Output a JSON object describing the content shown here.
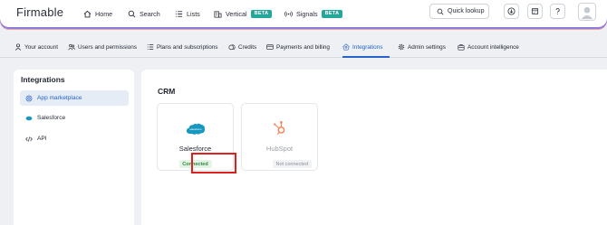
{
  "brand": {
    "name": "Firmable"
  },
  "topnav": {
    "items": [
      {
        "label": "Home",
        "icon": "home-icon"
      },
      {
        "label": "Search",
        "icon": "search-icon"
      },
      {
        "label": "Lists",
        "icon": "list-icon"
      },
      {
        "label": "Vertical",
        "icon": "building-icon",
        "badge": "BETA"
      },
      {
        "label": "Signals",
        "icon": "signal-icon",
        "badge": "BETA"
      }
    ],
    "quick_lookup": "Quick lookup",
    "right_icons": [
      "download-icon",
      "calendar-icon",
      "help-icon",
      "avatar"
    ]
  },
  "settings_tabs": [
    {
      "label": "Your account",
      "icon": "person-icon"
    },
    {
      "label": "Users and permissions",
      "icon": "users-icon"
    },
    {
      "label": "Plans and subscriptions",
      "icon": "list-icon"
    },
    {
      "label": "Credits",
      "icon": "credits-icon"
    },
    {
      "label": "Payments and billing",
      "icon": "card-icon"
    },
    {
      "label": "Integrations",
      "icon": "integrations-icon",
      "active": true
    },
    {
      "label": "Admin settings",
      "icon": "gear-icon"
    },
    {
      "label": "Account intelligence",
      "icon": "briefcase-icon"
    }
  ],
  "sidebar": {
    "title": "Integrations",
    "items": [
      {
        "label": "App marketplace",
        "icon": "marketplace-icon",
        "active": true
      },
      {
        "label": "Salesforce",
        "icon": "salesforce-icon"
      },
      {
        "label": "API",
        "icon": "code-icon"
      }
    ]
  },
  "main": {
    "section_title": "CRM",
    "cards": [
      {
        "name": "Salesforce",
        "status": "Connected",
        "logo_text": "salesforce"
      },
      {
        "name": "HubSpot",
        "status": "Not connected"
      }
    ]
  },
  "colors": {
    "accent": "#2563c9",
    "beta_badge": "#25a69a",
    "connected_bg": "#e3f3e5",
    "connected_text": "#2e8b3d",
    "highlight": "#e0201c",
    "salesforce_blue": "#1798c1",
    "hubspot_orange": "#f08a5d"
  }
}
